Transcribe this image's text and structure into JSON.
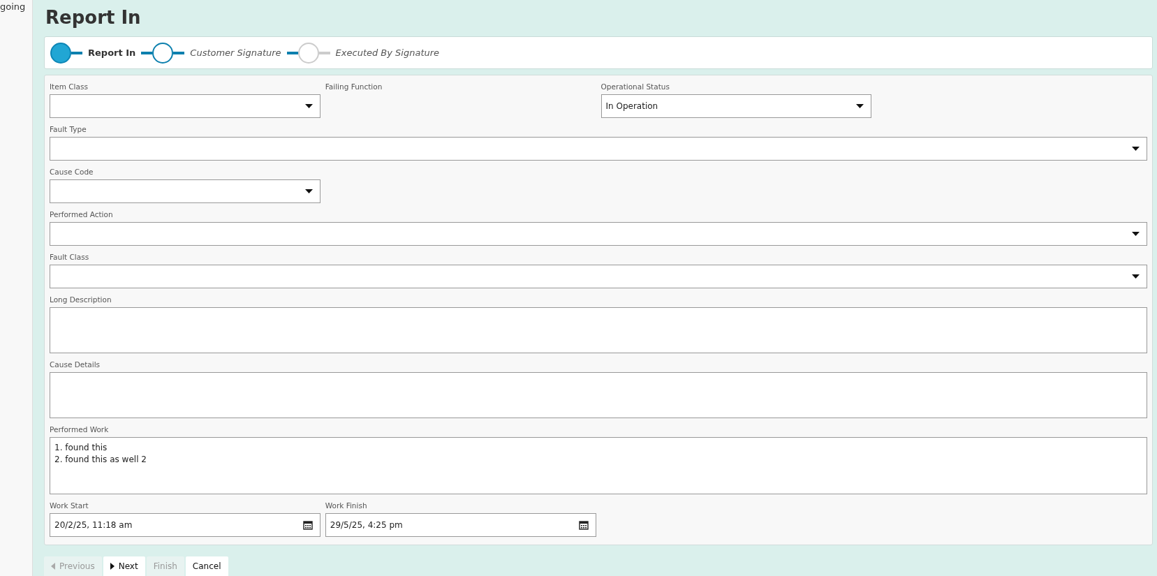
{
  "sidebar": {
    "text": "going"
  },
  "page_title": "Report In",
  "steps": [
    {
      "label": "Report In",
      "kind": "current"
    },
    {
      "label": "Customer Signature",
      "kind": "next"
    },
    {
      "label": "Executed By Signature",
      "kind": "pending"
    }
  ],
  "form_rows": [
    {
      "fields": [
        {
          "label": "Item Class",
          "kind": "select"
        },
        {
          "label": "Failing Function",
          "kind": "label"
        },
        {
          "label": "Operational Status",
          "kind": "select",
          "value": "In Operation"
        }
      ]
    },
    {
      "fields": [
        {
          "label": "Fault Type",
          "kind": "select-wide"
        }
      ]
    },
    {
      "fields": [
        {
          "label": "Cause Code",
          "kind": "select"
        }
      ]
    },
    {
      "fields": [
        {
          "label": "Performed Action",
          "kind": "select-wide"
        }
      ]
    },
    {
      "fields": [
        {
          "label": "Fault Class",
          "kind": "select-wide"
        }
      ]
    },
    {
      "fields": [
        {
          "label": "Long Description",
          "kind": "textarea"
        }
      ]
    },
    {
      "fields": [
        {
          "label": "Cause Details",
          "kind": "textarea"
        }
      ]
    },
    {
      "fields": [
        {
          "label": "Performed Work",
          "kind": "textarea-tall",
          "value": "1. found this\n2. found this as well 2"
        }
      ]
    },
    {
      "fields": [
        {
          "label": "Work Start",
          "kind": "date",
          "value": "20/2/25, 11:18 am"
        },
        {
          "label": "Work Finish",
          "kind": "date",
          "value": "29/5/25, 4:25 pm"
        }
      ]
    }
  ],
  "buttons": [
    {
      "label": "Previous",
      "disabled": true
    },
    {
      "label": "Next",
      "disabled": false
    },
    {
      "label": "Finish",
      "disabled": true
    },
    {
      "label": "Cancel",
      "disabled": false
    }
  ]
}
